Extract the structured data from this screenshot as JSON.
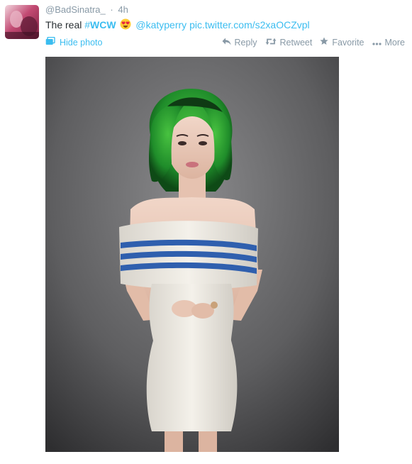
{
  "tweet": {
    "username": "@BadSinatra_",
    "separator": "·",
    "time": "4h",
    "text_prefix": "The real",
    "hashtag_symbol": "#",
    "hashtag": "WCW",
    "emoji": "heart-eyes-emoji",
    "mention": "@katyperry",
    "link": "pic.twitter.com/s2xaOCZvpl"
  },
  "media": {
    "hide_photo_label": "Hide photo"
  },
  "actions": {
    "reply": "Reply",
    "retweet": "Retweet",
    "favorite": "Favorite",
    "more": "More"
  },
  "colors": {
    "link": "#3bbdf0",
    "meta": "#8899a6",
    "text": "#292f33"
  }
}
